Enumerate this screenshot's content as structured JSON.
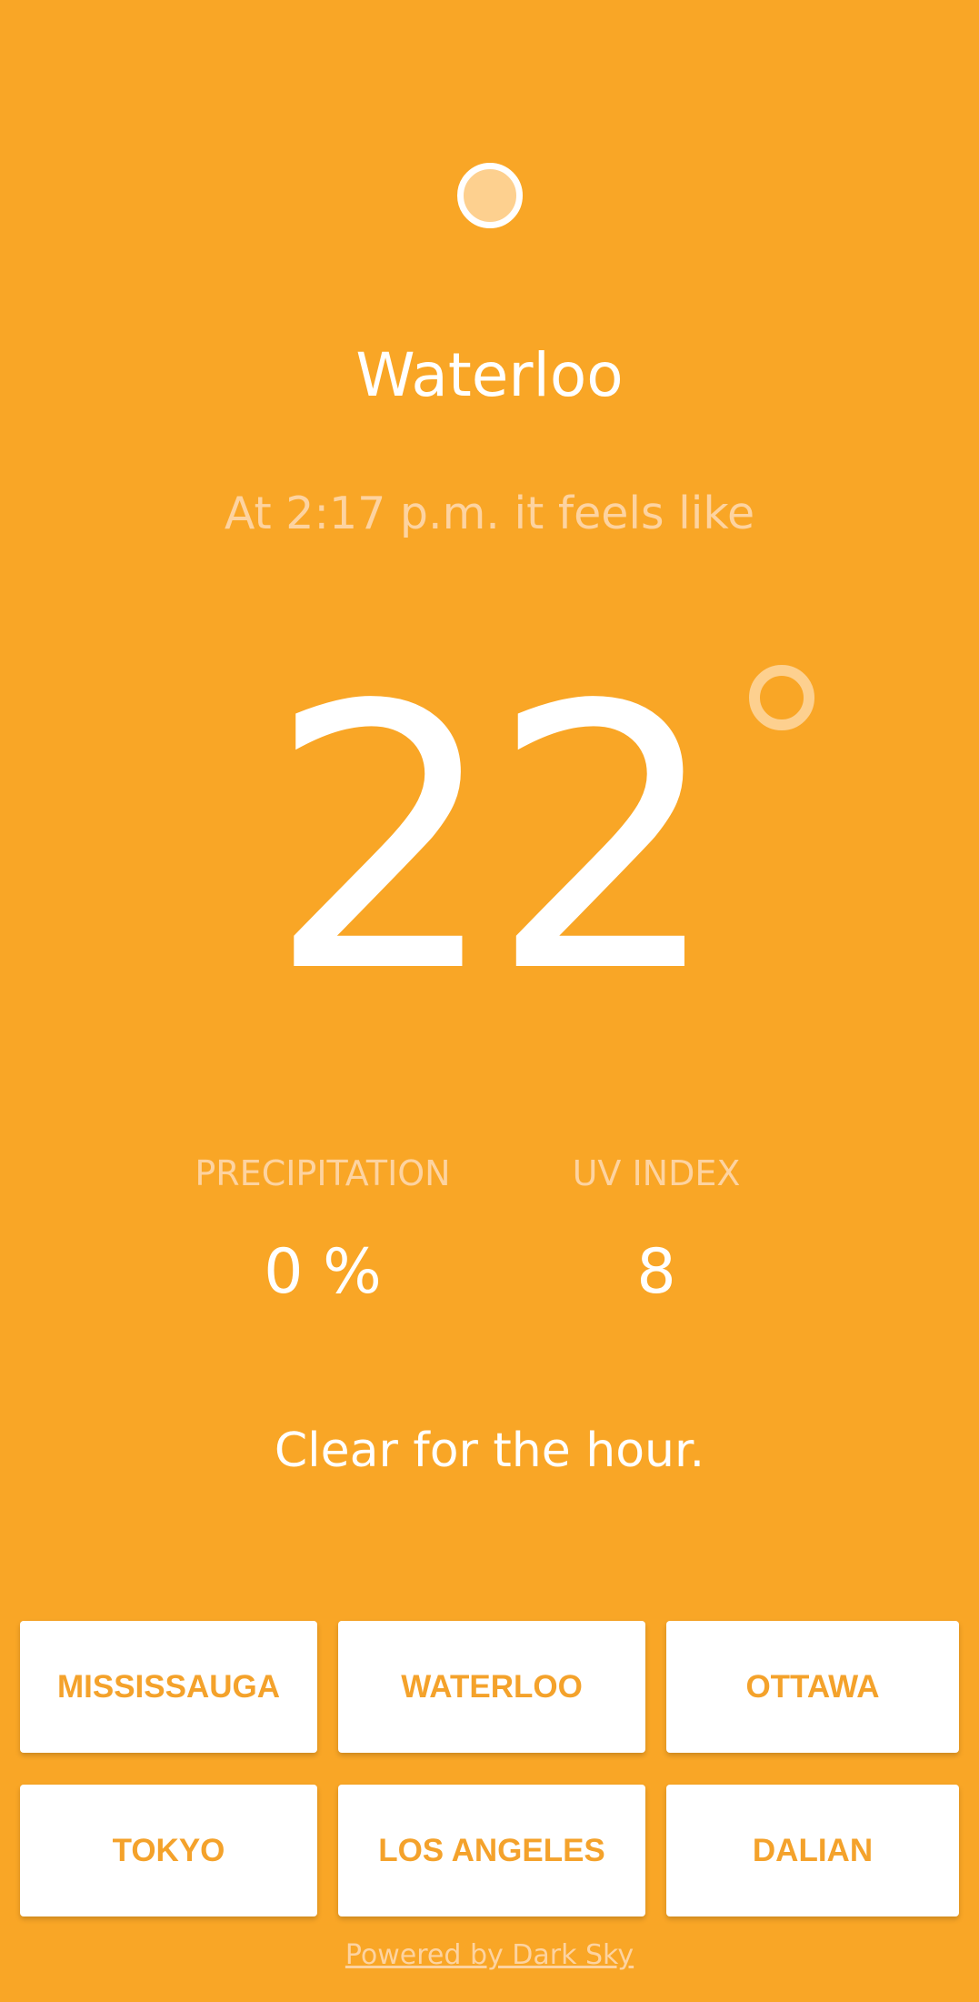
{
  "weather": {
    "icon": "sun-icon",
    "city": "Waterloo",
    "feels_like_text": "At 2:17 p.m. it feels like",
    "temperature": "22",
    "degree_icon": "degree-icon",
    "precipitation": {
      "label": "PRECIPITATION",
      "value": "0 %"
    },
    "uv_index": {
      "label": "UV INDEX",
      "value": "8"
    },
    "summary": "Clear for the hour."
  },
  "cities": [
    "MISSISSAUGA",
    "WATERLOO",
    "OTTAWA",
    "TOKYO",
    "LOS ANGELES",
    "DALIAN"
  ],
  "footer": {
    "link_text": "Powered by Dark Sky"
  },
  "colors": {
    "background": "#F9A626",
    "accent_text": "#F4A22B",
    "muted_text": "#FDD3A0",
    "primary_text": "#FFFFFF"
  }
}
